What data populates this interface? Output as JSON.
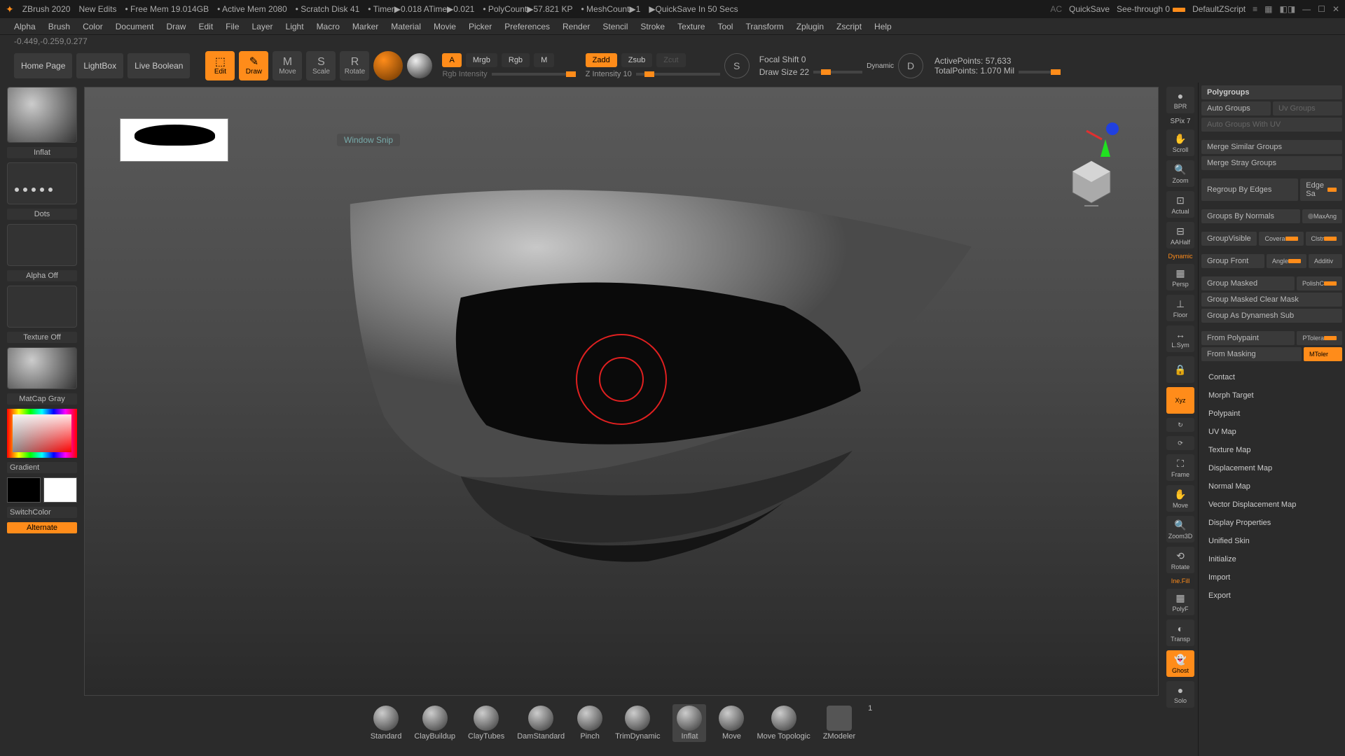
{
  "topbar": {
    "app": "ZBrush 2020",
    "edits": "New Edits",
    "freemem": "• Free Mem 19.014GB",
    "activemem": "• Active Mem 2080",
    "scratch": "• Scratch Disk 41",
    "timer": "• Timer▶0.018 ATime▶0.021",
    "poly": "• PolyCount▶57.821 KP",
    "mesh": "• MeshCount▶1",
    "quicksave": "▶QuickSave In 50 Secs",
    "ac": "AC",
    "qs": "QuickSave",
    "seethrough": "See-through  0",
    "defaultz": "DefaultZScript"
  },
  "menus": [
    "Alpha",
    "Brush",
    "Color",
    "Document",
    "Draw",
    "Edit",
    "File",
    "Layer",
    "Light",
    "Macro",
    "Marker",
    "Material",
    "Movie",
    "Picker",
    "Preferences",
    "Render",
    "Stencil",
    "Stroke",
    "Texture",
    "Tool",
    "Transform",
    "Zplugin",
    "Zscript",
    "Help"
  ],
  "coords": "-0.449,-0.259,0.277",
  "tabs": {
    "home": "Home Page",
    "lightbox": "LightBox",
    "liveboolean": "Live Boolean"
  },
  "tools": {
    "edit": "Edit",
    "draw": "Draw",
    "move": "Move",
    "scale": "Scale",
    "rotate": "Rotate"
  },
  "rgb": {
    "a": "A",
    "mrgb": "Mrgb",
    "rgb": "Rgb",
    "m": "M",
    "rgbint": "Rgb Intensity"
  },
  "z": {
    "zadd": "Zadd",
    "zsub": "Zsub",
    "zcut": "Zcut",
    "zint": "Z Intensity  10"
  },
  "focal": {
    "label": "Focal Shift  0",
    "draw": "Draw Size  22",
    "dynamic": "Dynamic"
  },
  "stats": {
    "active": "ActivePoints: 57,633",
    "total": "TotalPoints: 1.070 Mil"
  },
  "left": {
    "inflat": "Inflat",
    "dots": "Dots",
    "alphaoff": "Alpha Off",
    "textureoff": "Texture Off",
    "matcap": "MatCap Gray",
    "gradient": "Gradient",
    "switch": "SwitchColor",
    "alternate": "Alternate"
  },
  "snip": "Window Snip",
  "rstrip": {
    "bpr": "BPR",
    "spix": "SPix 7",
    "scroll": "Scroll",
    "zoom": "Zoom",
    "actual": "Actual",
    "aahalf": "AAHalf",
    "persp": "Persp",
    "dynamic": "Dynamic",
    "floor": "Floor",
    "lsym": "L.Sym",
    "xyz": "Xyz",
    "frame": "Frame",
    "move": "Move",
    "zoom3d": "Zoom3D",
    "rotate": "Rotate",
    "inefill": "Ine.Fill",
    "polyf": "PolyF",
    "transp": "Transp",
    "ghost": "Ghost",
    "solo": "Solo"
  },
  "brushes": [
    "Standard",
    "ClayBuildup",
    "ClayTubes",
    "DamStandard",
    "Pinch",
    "TrimDynamic",
    "Inflat",
    "Move",
    "Move Topologic",
    "ZModeler"
  ],
  "brushsel": 6,
  "zcount": "1",
  "polygroups": {
    "header": "Polygroups",
    "autogroups": "Auto Groups",
    "uvgroups": "Uv Groups",
    "autouv": "Auto Groups With UV",
    "mergesim": "Merge Similar Groups",
    "mergestray": "Merge Stray Groups",
    "regroup": "Regroup By Edges",
    "edgesa": "Edge Sa",
    "bynormals": "Groups By Normals",
    "maxang": "MaxAng",
    "visible": "GroupVisible",
    "covera": "Covera",
    "clstr": "Clstr",
    "front": "Group Front",
    "angle": "Angle",
    "additiv": "Additiv",
    "masked": "Group Masked",
    "polishc": "PolishC",
    "maskedclear": "Group Masked Clear Mask",
    "dynamesh": "Group As Dynamesh Sub",
    "frompoly": "From Polypaint",
    "ptolera": "PTolera",
    "frommask": "From Masking",
    "mtoler": "MToler"
  },
  "sections": [
    "Contact",
    "Morph Target",
    "Polypaint",
    "UV Map",
    "Texture Map",
    "Displacement Map",
    "Normal Map",
    "Vector Displacement Map",
    "Display Properties",
    "Unified Skin",
    "Initialize",
    "Import",
    "Export"
  ]
}
